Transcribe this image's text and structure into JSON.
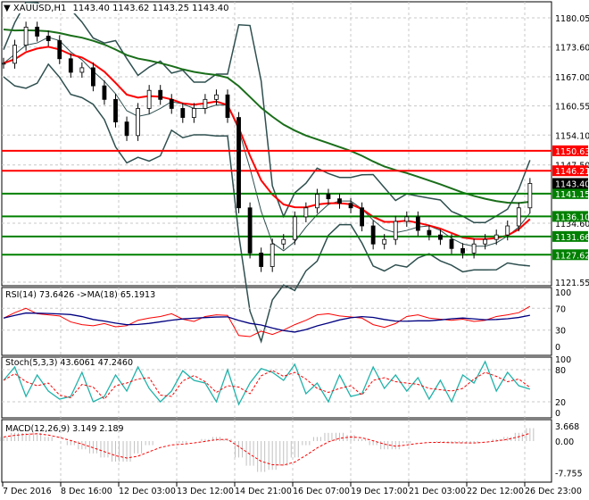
{
  "header": {
    "symbol": "XAUUSD,H1",
    "ohlc": "1143.40 1143.62 1143.25 1143.40"
  },
  "colors": {
    "bull_level": "#008000",
    "bear_level": "#ff0000",
    "ma_fast": "#ff0000",
    "ma_slow": "#1a6e1a",
    "bands": "#2f4f4f",
    "rsi": "#ff0000",
    "rsi_ma": "#000080",
    "stoch_main": "#20b2aa",
    "stoch_signal": "#ff0000",
    "macd_hist": "#c0c0c0",
    "macd_signal": "#ff0000"
  },
  "chart_data": [
    {
      "type": "candlestick",
      "title": "XAUUSD,H1",
      "ylim": [
        1121.55,
        1180.05
      ],
      "y_ticks": [
        "1180.05",
        "1173.60",
        "1167.00",
        "1160.55",
        "1154.10",
        "1147.50",
        "1134.60",
        "1121.55"
      ],
      "x_ticks": [
        "7 Dec 2016",
        "8 Dec 16:00",
        "12 Dec 03:00",
        "13 Dec 12:00",
        "14 Dec 21:00",
        "16 Dec 07:00",
        "19 Dec 17:00",
        "21 Dec 03:00",
        "22 Dec 12:00",
        "26 Dec 23:00"
      ],
      "close": [
        1170,
        1174,
        1178,
        1176,
        1175,
        1171,
        1168,
        1169,
        1165,
        1162,
        1157,
        1154,
        1160,
        1164,
        1162,
        1160,
        1158,
        1160,
        1162,
        1163,
        1158,
        1138,
        1128,
        1125,
        1130,
        1131,
        1136,
        1138,
        1141,
        1140,
        1139,
        1138,
        1134,
        1130,
        1131,
        1135,
        1136,
        1133,
        1132,
        1131,
        1129,
        1128,
        1130,
        1131,
        1132,
        1134,
        1138,
        1143.4
      ],
      "levels": [
        {
          "value": "1150.63",
          "kind": "resistance"
        },
        {
          "value": "1146.21",
          "kind": "resistance"
        },
        {
          "value": "1141.15",
          "kind": "support"
        },
        {
          "value": "1136.10",
          "kind": "support"
        },
        {
          "value": "1131.66",
          "kind": "support"
        },
        {
          "value": "1127.62",
          "kind": "support"
        }
      ],
      "current_price": "1143.40"
    },
    {
      "type": "line",
      "label": "RSI(14) 73.6426  ->MA(18) 65.1913",
      "ylim": [
        0,
        100
      ],
      "y_ticks": [
        "100",
        "70",
        "30",
        "0"
      ],
      "values": [
        52,
        62,
        70,
        60,
        58,
        56,
        45,
        40,
        38,
        42,
        36,
        38,
        48,
        52,
        55,
        60,
        50,
        46,
        55,
        58,
        57,
        20,
        18,
        28,
        22,
        30,
        40,
        48,
        58,
        60,
        56,
        54,
        52,
        40,
        35,
        42,
        55,
        58,
        52,
        50,
        48,
        50,
        46,
        48,
        55,
        58,
        62,
        73.6
      ]
    },
    {
      "type": "line",
      "label": "Stoch(5,3,3) 43.6061 47.2460",
      "ylim": [
        0,
        100
      ],
      "y_ticks": [
        "100",
        "80",
        "20",
        "0"
      ],
      "values": [
        60,
        85,
        30,
        70,
        40,
        25,
        30,
        75,
        20,
        30,
        70,
        40,
        85,
        45,
        20,
        40,
        78,
        60,
        55,
        20,
        80,
        15,
        55,
        82,
        75,
        60,
        90,
        35,
        55,
        20,
        70,
        30,
        35,
        85,
        45,
        70,
        40,
        65,
        25,
        60,
        20,
        70,
        55,
        95,
        40,
        75,
        50,
        43.6
      ]
    },
    {
      "type": "bar",
      "label": "MACD(12,26,9) 3.149 2.189",
      "ylim": [
        -7.755,
        3.668
      ],
      "y_ticks": [
        "3.668",
        "0.00",
        "-7.755"
      ],
      "values": [
        1,
        2,
        2,
        2,
        1,
        0,
        -1,
        -2,
        -3,
        -4,
        -5,
        -5,
        -3,
        -1,
        0,
        0,
        -0.5,
        0,
        0.5,
        1,
        0.5,
        -4,
        -6,
        -7.5,
        -7,
        -6,
        -4,
        -1,
        1,
        2,
        2,
        1.5,
        0.5,
        -1,
        -2,
        -2,
        -0.5,
        0,
        0,
        -0.3,
        -0.5,
        -0.5,
        -0.5,
        0,
        0.5,
        1,
        2,
        3.149
      ]
    }
  ]
}
